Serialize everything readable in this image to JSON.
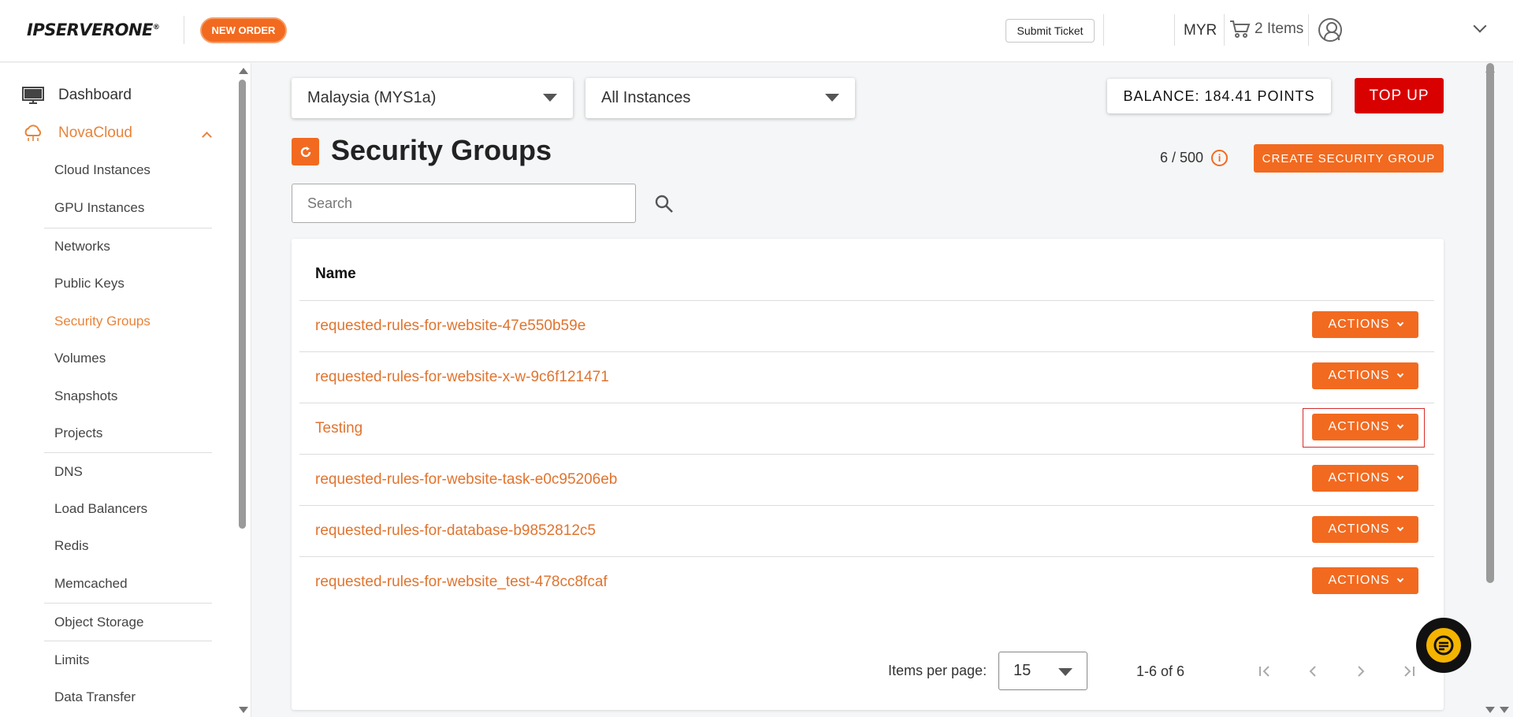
{
  "header": {
    "logo_text": "IPSERVERONE",
    "logo_mark": "®",
    "new_order_label": "NEW ORDER",
    "submit_ticket_label": "Submit Ticket",
    "currency": "MYR",
    "cart_label": "2 Items"
  },
  "sidebar": {
    "dashboard_label": "Dashboard",
    "section_label": "NovaCloud",
    "items": [
      {
        "label": "Cloud Instances"
      },
      {
        "label": "GPU Instances"
      },
      {
        "label": "Networks"
      },
      {
        "label": "Public Keys"
      },
      {
        "label": "Security Groups"
      },
      {
        "label": "Volumes"
      },
      {
        "label": "Snapshots"
      },
      {
        "label": "Projects"
      },
      {
        "label": "DNS"
      },
      {
        "label": "Load Balancers"
      },
      {
        "label": "Redis"
      },
      {
        "label": "Memcached"
      },
      {
        "label": "Object Storage"
      },
      {
        "label": "Limits"
      },
      {
        "label": "Data Transfer"
      }
    ]
  },
  "filters": {
    "region": "Malaysia (MYS1a)",
    "instances": "All Instances"
  },
  "balance_label": "BALANCE: 184.41 POINTS",
  "top_up_label": "TOP UP",
  "page": {
    "title": "Security Groups",
    "quota": "6 / 500",
    "info_icon": "i",
    "create_label": "CREATE SECURITY GROUP",
    "search_placeholder": "Search"
  },
  "table": {
    "column_name": "Name",
    "actions_label": "ACTIONS",
    "rows": [
      {
        "name": "requested-rules-for-website-47e550b59e"
      },
      {
        "name": "requested-rules-for-website-x-w-9c6f121471"
      },
      {
        "name": "Testing"
      },
      {
        "name": "requested-rules-for-website-task-e0c95206eb"
      },
      {
        "name": "requested-rules-for-database-b9852812c5"
      },
      {
        "name": "requested-rules-for-website_test-478cc8fcaf"
      }
    ]
  },
  "pagination": {
    "items_per_page_label": "Items per page:",
    "items_per_page_value": "15",
    "range_label": "1-6 of 6"
  },
  "colors": {
    "accent": "#f26a1f",
    "link": "#e0742f",
    "top_up": "#d90000",
    "active_nav": "#e8833a"
  }
}
